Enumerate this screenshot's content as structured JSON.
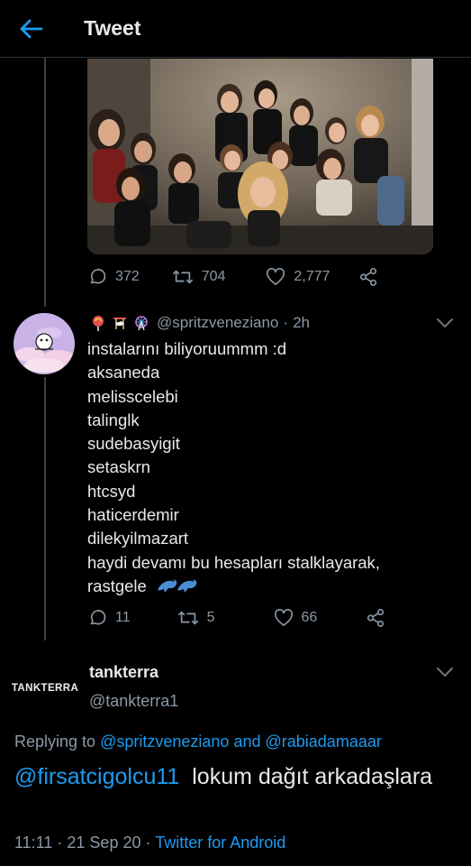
{
  "header": {
    "title": "Tweet",
    "back_icon": "arrow-left-icon",
    "accent": "#1d9bf0"
  },
  "photo_tweet": {
    "stats": {
      "replies": "372",
      "retweets": "704",
      "likes": "2,777"
    }
  },
  "reply_tweet": {
    "emojis": [
      "lollipop",
      "carousel-horse",
      "ferris-wheel"
    ],
    "handle": "@spritzveneziano",
    "separator": "·",
    "time": "2h",
    "lines": [
      "instalarını biliyoruummm :d",
      "aksaneda",
      "melisscelebi",
      "talinglk",
      "sudebasyigit",
      "setaskrn",
      "htcsyd",
      "haticerdemir",
      "dilekyilmazart",
      "haydi devamı bu hesapları stalklayarak,",
      "rastgele"
    ],
    "trailing_emojis": [
      "dolphin",
      "dolphin"
    ],
    "stats": {
      "replies": "11",
      "retweets": "5",
      "likes": "66"
    }
  },
  "main_tweet": {
    "avatar_text": "TANKTERRA",
    "name": "tankterra",
    "handle": "@tankterra1",
    "replying_prefix": "Replying to",
    "replying_user1": "@spritzveneziano",
    "replying_and": "and",
    "replying_user2": "@rabiadamaaar",
    "mention": "@firsatcigolcu11",
    "text": "lokum dağıt arkadaşlara",
    "time": "11:11",
    "dot1": "·",
    "date": "21 Sep 20",
    "dot2": "·",
    "source": "Twitter for Android"
  }
}
